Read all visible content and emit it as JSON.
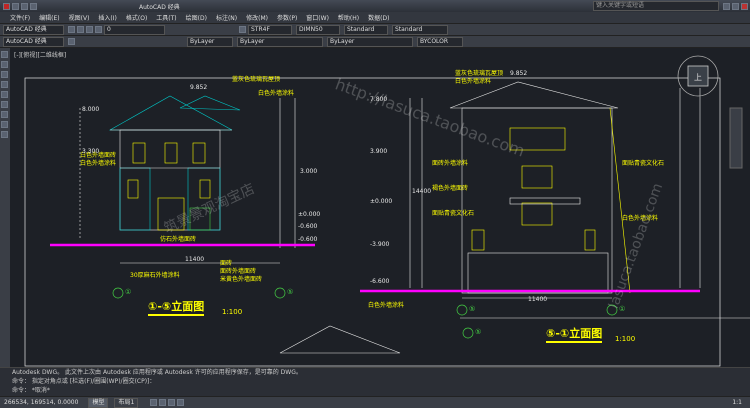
{
  "app": {
    "window_title": "AutoCAD 经典",
    "doc_tab": "AutoCAD 经典",
    "search_placeholder": "键入关键字或短语",
    "viewport_label": "[-][俯视][二维线框]"
  },
  "menus": [
    "文件(F)",
    "编辑(E)",
    "视图(V)",
    "插入(I)",
    "格式(O)",
    "工具(T)",
    "绘图(D)",
    "标注(N)",
    "修改(M)",
    "参数(P)",
    "窗口(W)",
    "帮助(H)",
    "数据(D)"
  ],
  "toolbar1": {
    "workspace": "AutoCAD 经典",
    "layer": "0",
    "textstyle": "STR4F",
    "dimstyle": "DIMN50",
    "tablestyle": "Standard",
    "mleaderstyle": "Standard"
  },
  "toolbar2": {
    "color": "ByLayer",
    "linetype": "ByLayer",
    "lineweight": "ByLayer",
    "plotstyle": "BYCOLOR"
  },
  "drawing": {
    "title_left": "①-⑤立面图",
    "scale_left": "1:100",
    "title_right": "⑤-①立面图",
    "scale_right": "1:100",
    "annot_left": [
      "蓝灰色琉璃瓦屋顶",
      "白色外墙涂料",
      "白色外墙面砖",
      "白色外墙涂料",
      "仿石外墙面砖",
      "30厚麻石外墙涂料",
      "面砖",
      "面砖外墙面砖",
      "米黄色外墙面砖"
    ],
    "annot_right": [
      "蓝灰色琉璃瓦屋顶",
      "白色外墙涂料",
      "面砖外墙涂料",
      "褐色外墙面砖",
      "面贴青瓷文化石",
      "面贴青瓷文化石",
      "白色外墙涂料",
      "白色外墙涂料"
    ],
    "dims_left": [
      "11400",
      "9.852",
      "8.000",
      "3.300",
      "3.000",
      "±0.000",
      "-0.600",
      "-0.600"
    ],
    "dims_right": [
      "11400",
      "9.852",
      "7.800",
      "3.900",
      "±0.000",
      "-3.900",
      "-6.600",
      "14400"
    ],
    "axis_labels": [
      "①",
      "⑤",
      "⑤",
      "①",
      "⑤"
    ],
    "watermarks": [
      "http://lasuca.taobao.com",
      "筑景景观淘宝店",
      "lasuca.taobao.com"
    ]
  },
  "command": {
    "line1": "Autodesk DWG。  此文件上次由 Autodesk 应用程序或 Autodesk 许可的应用程序保存，是可靠的 DWG。",
    "line2": "命令： 指定对角点或 [栏选(F)/圈围(WP)/圈交(CP)]：",
    "line3": "命令：  *取消*"
  },
  "status": {
    "tabs": [
      "模型",
      "布局1"
    ],
    "coords": "266534, 169514, 0.0000",
    "scale": "1:1"
  },
  "colors": {
    "magenta": "#ff00ff",
    "yellow": "#ffff00",
    "cyan": "#00c8c8",
    "green": "#44cc44",
    "white": "#e8e8e8"
  }
}
